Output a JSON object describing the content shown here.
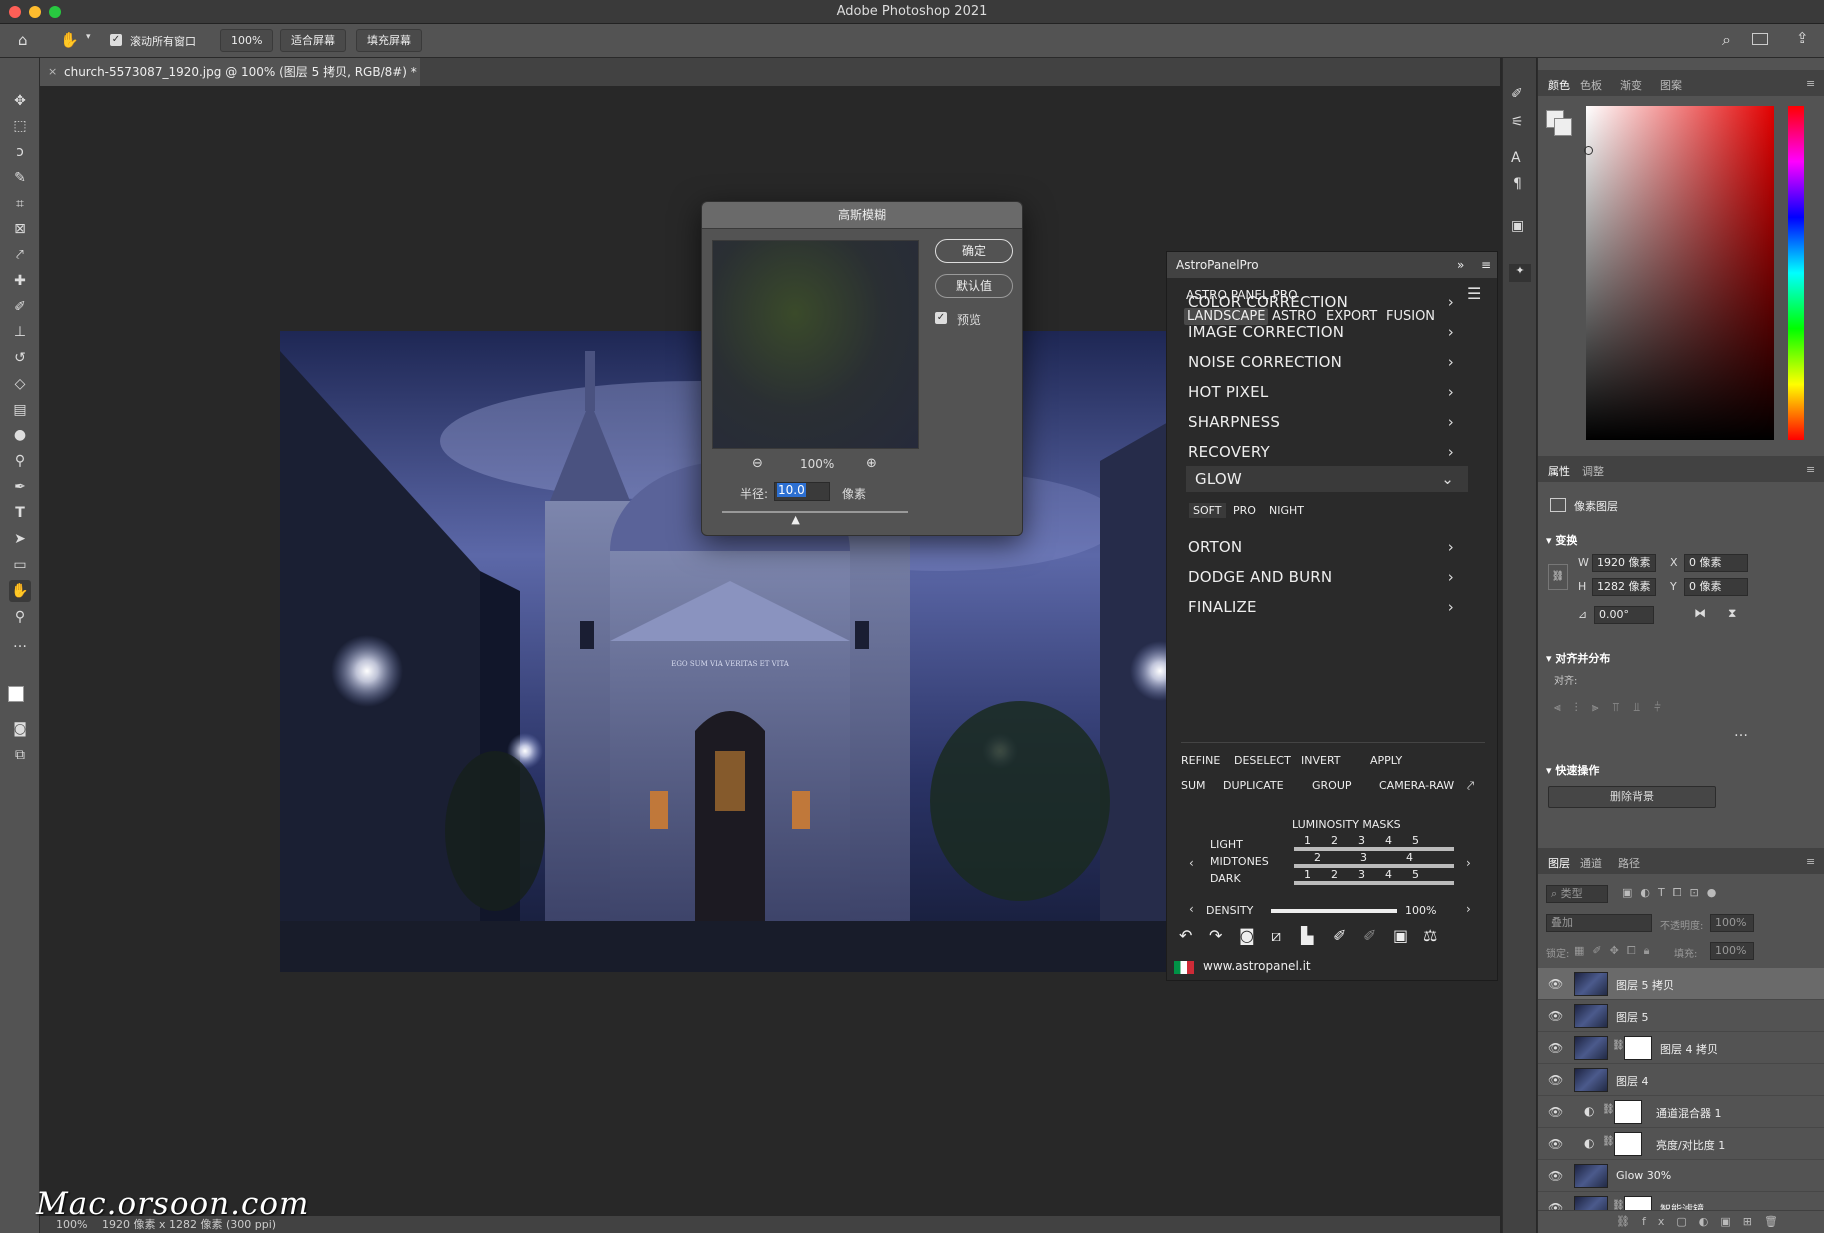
{
  "window": {
    "title": "Adobe Photoshop 2021"
  },
  "options_bar": {
    "scroll_all_label": "滚动所有窗口",
    "zoom_value": "100%",
    "fit_screen": "适合屏幕",
    "fill_screen": "填充屏幕"
  },
  "document_tab": {
    "title": "church-5573087_1920.jpg @ 100% (图层 5 拷贝, RGB/8#) *"
  },
  "status_bar": {
    "zoom": "100%",
    "doc_info": "1920 像素 x 1282 像素 (300 ppi)"
  },
  "watermark": {
    "text": "Mac.orsoon.com"
  },
  "gaussian_dialog": {
    "title": "高斯模糊",
    "ok": "确定",
    "default": "默认值",
    "preview": "预览",
    "zoom": "100%",
    "radius_label": "半径:",
    "radius_value": "10.0",
    "radius_unit": "像素",
    "slider_fraction": 0.4
  },
  "astro_panel": {
    "tab_title": "AstroPanelPro",
    "header": "ASTRO PANEL PRO",
    "tabs": [
      "LANDSCAPE",
      "ASTRO",
      "EXPORT",
      "FUSION"
    ],
    "active_tab": "LANDSCAPE",
    "menu_top": [
      "COLOR CORRECTION",
      "IMAGE CORRECTION",
      "NOISE CORRECTION",
      "HOT PIXEL",
      "SHARPNESS",
      "RECOVERY"
    ],
    "glow": {
      "label": "GLOW",
      "sub": [
        "SOFT",
        "PRO",
        "NIGHT"
      ],
      "active_sub": "SOFT"
    },
    "menu_bottom": [
      "ORTON",
      "DODGE AND BURN",
      "FINALIZE"
    ],
    "actions_row1": [
      "REFINE",
      "DESELECT",
      "INVERT",
      "APPLY"
    ],
    "actions_row2": [
      "SUM",
      "DUPLICATE",
      "GROUP",
      "CAMERA-RAW"
    ],
    "lum_title": "LUMINOSITY MASKS",
    "lum_labels": [
      "LIGHT",
      "MIDTONES",
      "DARK"
    ],
    "light_nums": [
      "1",
      "2",
      "3",
      "4",
      "5"
    ],
    "mid_nums": [
      "2",
      "3",
      "4"
    ],
    "dark_nums": [
      "1",
      "2",
      "3",
      "4",
      "5"
    ],
    "density_label": "DENSITY",
    "density_value": "100%",
    "density_fraction": 1.0,
    "website": "www.astropanel.it"
  },
  "color_panel": {
    "tabs": [
      "颜色",
      "色板",
      "渐变",
      "图案"
    ],
    "active_tab": "颜色"
  },
  "properties_panel": {
    "tabs": [
      "属性",
      "调整"
    ],
    "active_tab": "属性",
    "type": "像素图层",
    "transform_title": "变换",
    "w_label": "W",
    "w_value": "1920 像素",
    "h_label": "H",
    "h_value": "1282 像素",
    "x_label": "X",
    "x_value": "0 像素",
    "y_label": "Y",
    "y_value": "0 像素",
    "angle_value": "0.00°",
    "align_title": "对齐并分布",
    "align_label": "对齐:",
    "quick_title": "快速操作",
    "remove_bg": "删除背景"
  },
  "layers_panel": {
    "tabs": [
      "图层",
      "通道",
      "路径"
    ],
    "active_tab": "图层",
    "filter_kind": "类型",
    "blend_mode": "叠加",
    "opacity_label": "不透明度:",
    "opacity_value": "100%",
    "lock_label": "锁定:",
    "fill_label": "填充:",
    "fill_value": "100%",
    "layers": [
      {
        "name": "图层 5 拷贝",
        "selected": true,
        "mask": false,
        "adjust": false
      },
      {
        "name": "图层 5",
        "selected": false,
        "mask": false,
        "adjust": false
      },
      {
        "name": "图层 4 拷贝",
        "selected": false,
        "mask": true,
        "adjust": false
      },
      {
        "name": "图层 4",
        "selected": false,
        "mask": false,
        "adjust": false
      },
      {
        "name": "通道混合器 1",
        "selected": false,
        "mask": true,
        "adjust": true
      },
      {
        "name": "亮度/对比度 1",
        "selected": false,
        "mask": true,
        "adjust": true
      },
      {
        "name": "Glow 30%",
        "selected": false,
        "mask": false,
        "adjust": false
      },
      {
        "name": "智能滤镜",
        "selected": false,
        "mask": true,
        "adjust": false
      }
    ]
  }
}
